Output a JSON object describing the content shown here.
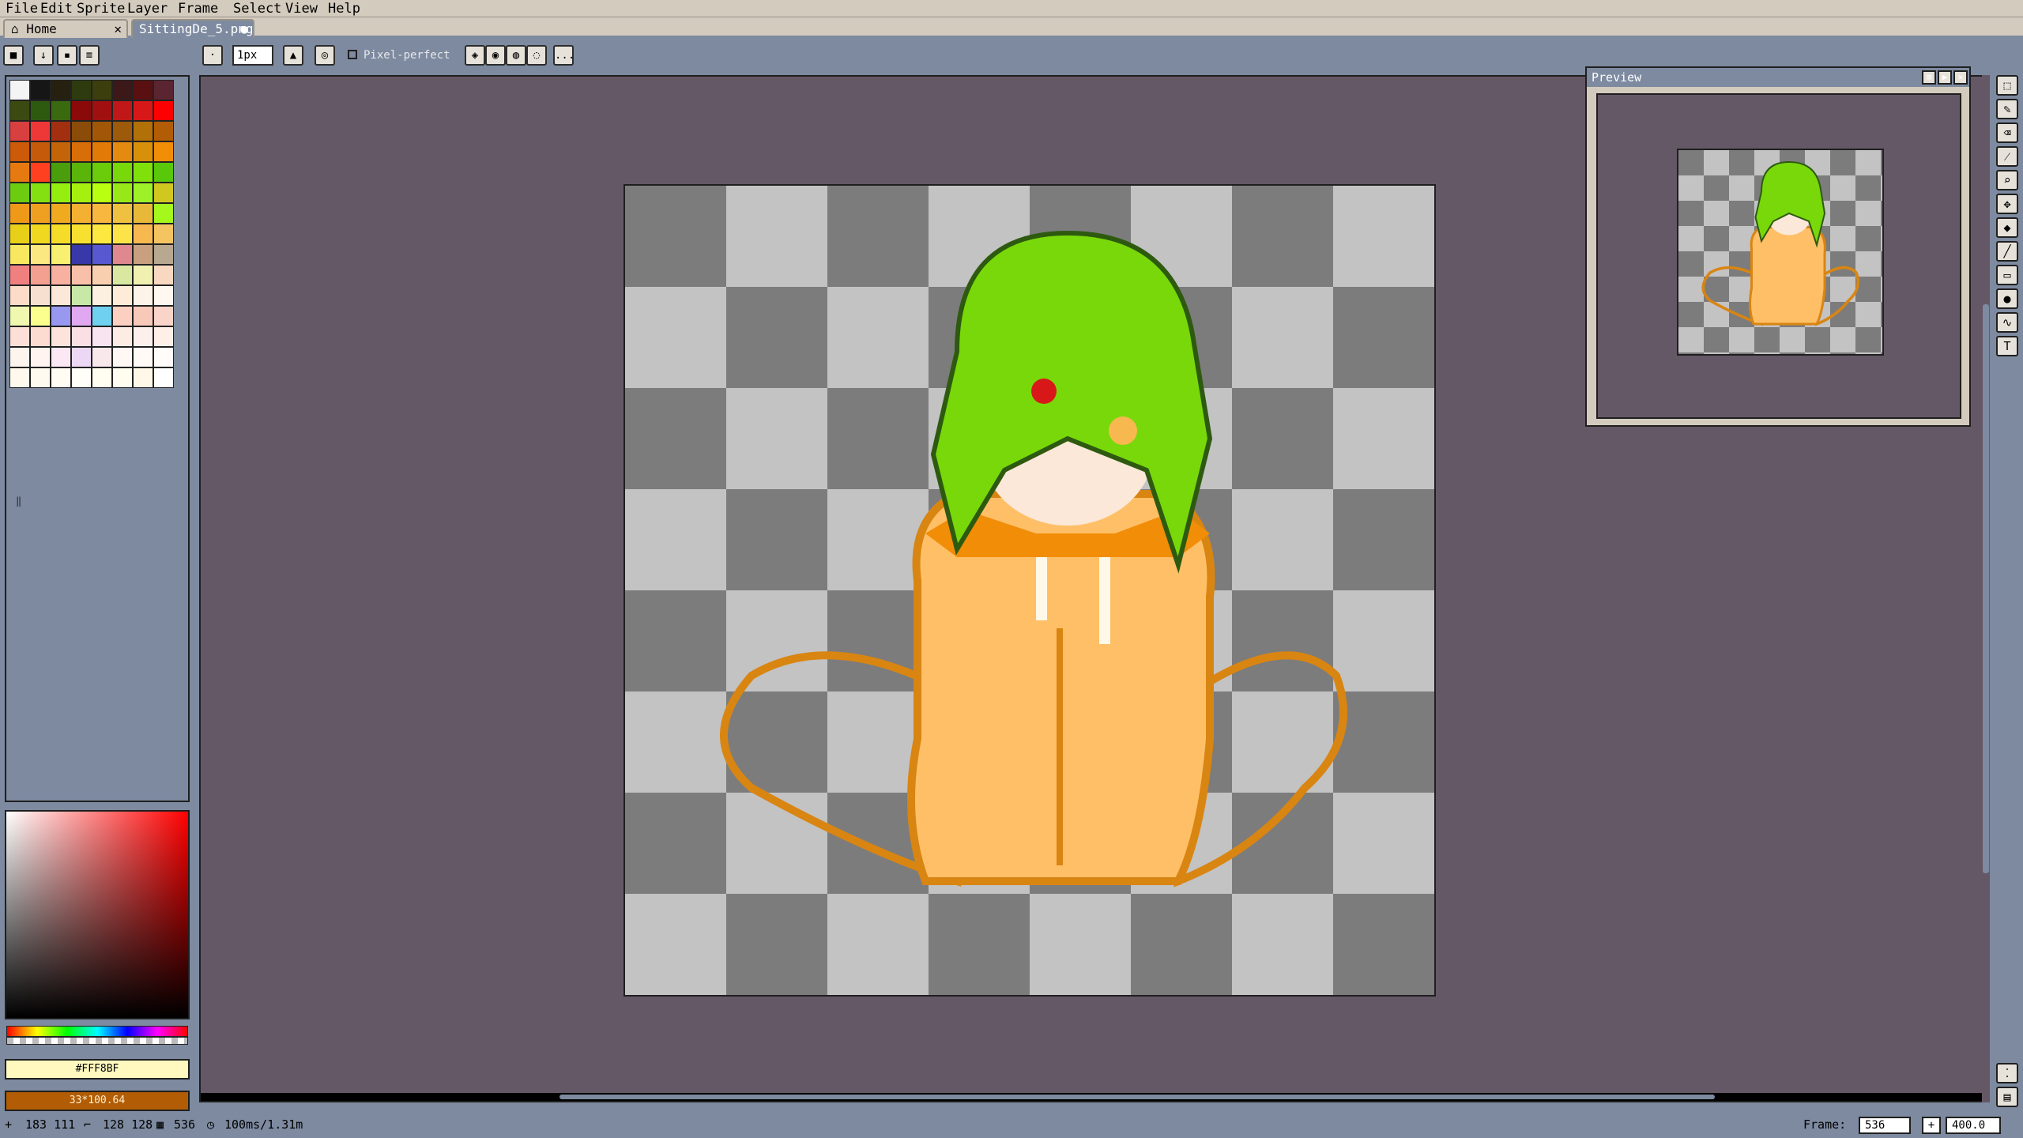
{
  "menubar": {
    "items": [
      "File",
      "Edit",
      "Sprite",
      "Layer",
      "Frame",
      "Select",
      "View",
      "Help"
    ]
  },
  "tabs": [
    {
      "label": "Home",
      "close": "✕"
    },
    {
      "label": "SittingDe_5.png",
      "close": "●"
    }
  ],
  "toolbar": {
    "brush_size": "1px",
    "pixel_perfect_label": "Pixel-perfect",
    "more": "..."
  },
  "palette": {
    "colors": [
      "#f4f4f4",
      "#161616",
      "#262010",
      "#2e3b0f",
      "#3c3f0d",
      "#3c1818",
      "#5a1010",
      "#5a2430",
      "#3b4a10",
      "#2e5a10",
      "#3a6a10",
      "#8a0a0a",
      "#a01010",
      "#c01818",
      "#d81818",
      "#ff0000",
      "#d84040",
      "#ee3838",
      "#a23010",
      "#8a4c08",
      "#a05808",
      "#9c5a0a",
      "#b27008",
      "#b25d05",
      "#cc5a08",
      "#c45a0a",
      "#c46408",
      "#d86e08",
      "#e27a08",
      "#e48a10",
      "#d8900a",
      "#f28d08",
      "#e67a10",
      "#ff4020",
      "#4a9e0c",
      "#5ab40a",
      "#6acc0a",
      "#78d80a",
      "#80e00a",
      "#5ac80a",
      "#6ccc10",
      "#84e010",
      "#94ee10",
      "#a6f010",
      "#b8ff10",
      "#98e818",
      "#9ef028",
      "#d0c820",
      "#ee9a18",
      "#f0a020",
      "#f0aa20",
      "#f4b030",
      "#f8b840",
      "#f0c040",
      "#e8b838",
      "#a4f81c",
      "#e8d018",
      "#f0d820",
      "#f4dc28",
      "#f8e030",
      "#fce840",
      "#fce448",
      "#f8b850",
      "#f4c460",
      "#f8e860",
      "#fce880",
      "#f8f070",
      "#3838a8",
      "#5858d0",
      "#e08890",
      "#c8a080",
      "#b8a890",
      "#f08080",
      "#f4a090",
      "#f8b0a0",
      "#f8c0a8",
      "#f8d0b0",
      "#d8e8a0",
      "#f0f0b0",
      "#f8d8c0",
      "#fcdcc8",
      "#f8e0d0",
      "#fce8d8",
      "#c8e8a8",
      "#fcf0e0",
      "#fcecd8",
      "#fcf4e8",
      "#fef8f0",
      "#f0f8b0",
      "#fbff8e",
      "#9898f0",
      "#e0a8f0",
      "#70d0f0",
      "#fcd0c0",
      "#f8c8b8",
      "#fad4c8",
      "#fce0d8",
      "#fcdcd0",
      "#fce4dc",
      "#fae0e4",
      "#f8e4f0",
      "#fcece4",
      "#fcf0ec",
      "#fef0e8",
      "#fef4ee",
      "#fff4f0",
      "#fce8f4",
      "#ecd8f4",
      "#f8e8ec",
      "#fff8f4",
      "#fffaf6",
      "#fffcfa",
      "#fff8ec",
      "#fffaf0",
      "#fffcf4",
      "#fffef8",
      "#fffef0",
      "#fffcf0",
      "#fff8e8",
      "#ffffff"
    ]
  },
  "colors": {
    "fg": "#FFF8BF",
    "bg_label": "33*100.64"
  },
  "preview": {
    "title": "Preview"
  },
  "status": {
    "cursor": "183 111",
    "size": "128 128",
    "frame_num": "536",
    "duration": "100ms/1.31m",
    "frame_label": "Frame:",
    "frame_value": "536",
    "zoom": "400.0"
  }
}
